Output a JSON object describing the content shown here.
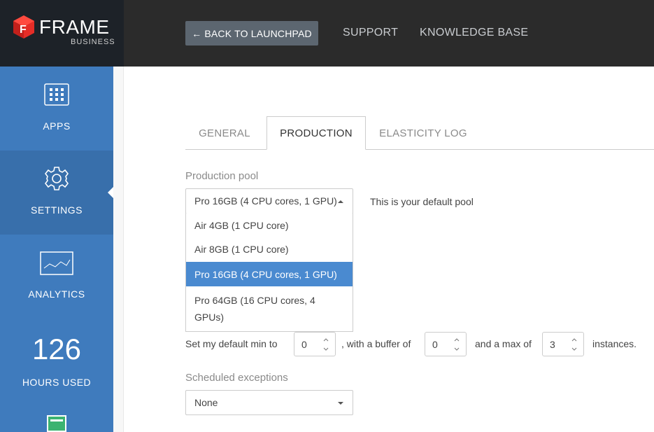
{
  "brand": {
    "name": "FRAME",
    "sub": "BUSINESS"
  },
  "topnav": {
    "back_label": "BACK TO LAUNCHPAD",
    "support": "SUPPORT",
    "knowledge_base": "KNOWLEDGE BASE"
  },
  "sidebar": {
    "apps": "APPS",
    "settings": "SETTINGS",
    "analytics": "ANALYTICS",
    "hours_value": "126",
    "hours_label": "HOURS USED"
  },
  "tabs": [
    "GENERAL",
    "PRODUCTION",
    "ELASTICITY LOG"
  ],
  "production_pool": {
    "label": "Production pool",
    "selected": "Pro 16GB (4 CPU cores, 1 GPU)",
    "note": "This is your default pool",
    "options": [
      "Air 4GB (1 CPU core)",
      "Air 8GB (1 CPU core)",
      "Pro 16GB (4 CPU cores, 1 GPU)",
      "Pro 64GB (16 CPU cores, 4 GPUs)"
    ]
  },
  "instances": {
    "prefix": "Set my default min to",
    "min": "0",
    "buffer_text": ", with a buffer of",
    "buffer": "0",
    "max_text": "and a max of",
    "max": "3",
    "suffix": "instances."
  },
  "exceptions": {
    "label": "Scheduled exceptions",
    "selected": "None"
  },
  "colors": {
    "sidebar": "#3f7bbd",
    "selected_option": "#4a8ad0",
    "brand_red": "#e52d27"
  }
}
